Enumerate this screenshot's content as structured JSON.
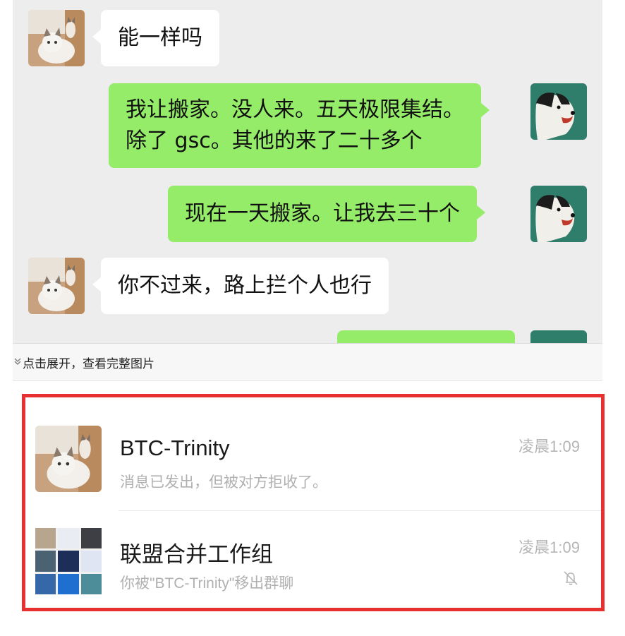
{
  "chat": {
    "messages": [
      {
        "side": "left",
        "text": "能一样吗"
      },
      {
        "side": "right",
        "lines": [
          "我让搬家。没人来。五天极限集结。",
          "除了 gsc。其他的来了二十多个"
        ]
      },
      {
        "side": "right",
        "text": "现在一天搬家。让我去三十个"
      },
      {
        "side": "left",
        "text": "你不过来，路上拦个人也行"
      }
    ],
    "expand_hint": "点击展开，查看完整图片",
    "expand_icon": "double-chevron-down-icon"
  },
  "conversations": [
    {
      "name": "BTC-Trinity",
      "time": "凌晨1:09",
      "preview": "消息已发出，但被对方拒收了。",
      "avatar": "cat-avatar"
    },
    {
      "name": "联盟合并工作组",
      "time": "凌晨1:09",
      "preview": "你被\"BTC-Trinity\"移出群聊",
      "avatar": "group-grid-avatar",
      "muted": true
    }
  ],
  "colors": {
    "chat_bg": "#ededed",
    "own_bubble": "#95ec69",
    "other_bubble": "#ffffff",
    "highlight_frame": "#e8302f"
  }
}
